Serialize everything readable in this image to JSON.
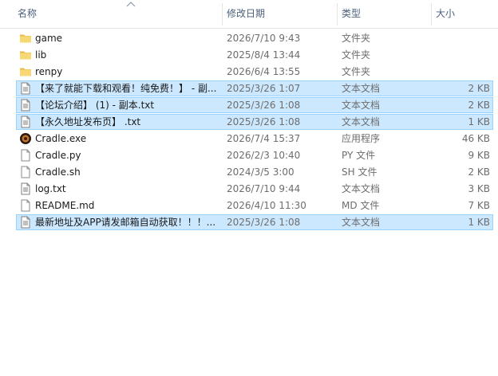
{
  "columns": {
    "name": "名称",
    "date": "修改日期",
    "type": "类型",
    "size": "大小"
  },
  "files": [
    {
      "name": "game",
      "date": "2026/7/10 9:43",
      "type": "文件夹",
      "size": "",
      "icon": "folder-icon",
      "selected": false
    },
    {
      "name": "lib",
      "date": "2025/8/4 13:44",
      "type": "文件夹",
      "size": "",
      "icon": "folder-icon",
      "selected": false
    },
    {
      "name": "renpy",
      "date": "2026/6/4 13:55",
      "type": "文件夹",
      "size": "",
      "icon": "folder-icon",
      "selected": false
    },
    {
      "name": "【来了就能下载和观看！纯免费！】 - 副...",
      "date": "2025/3/26 1:07",
      "type": "文本文档",
      "size": "2 KB",
      "icon": "text-file-icon",
      "selected": true
    },
    {
      "name": "【论坛介绍】 (1) - 副本.txt",
      "date": "2025/3/26 1:08",
      "type": "文本文档",
      "size": "2 KB",
      "icon": "text-file-icon",
      "selected": true
    },
    {
      "name": "【永久地址发布页】 .txt",
      "date": "2025/3/26 1:08",
      "type": "文本文档",
      "size": "1 KB",
      "icon": "text-file-icon",
      "selected": true
    },
    {
      "name": "Cradle.exe",
      "date": "2026/7/4 15:37",
      "type": "应用程序",
      "size": "46 KB",
      "icon": "app-exe-icon",
      "selected": false
    },
    {
      "name": "Cradle.py",
      "date": "2026/2/3 10:40",
      "type": "PY 文件",
      "size": "9 KB",
      "icon": "blank-file-icon",
      "selected": false
    },
    {
      "name": "Cradle.sh",
      "date": "2024/3/5 3:00",
      "type": "SH 文件",
      "size": "2 KB",
      "icon": "blank-file-icon",
      "selected": false
    },
    {
      "name": "log.txt",
      "date": "2026/7/10 9:44",
      "type": "文本文档",
      "size": "3 KB",
      "icon": "text-file-icon",
      "selected": false
    },
    {
      "name": "README.md",
      "date": "2026/4/10 11:30",
      "type": "MD 文件",
      "size": "7 KB",
      "icon": "blank-file-icon",
      "selected": false
    },
    {
      "name": "最新地址及APP请发邮箱自动获取！！！...",
      "date": "2025/3/26 1:08",
      "type": "文本文档",
      "size": "1 KB",
      "icon": "text-file-icon",
      "selected": true
    }
  ],
  "colors": {
    "selection_bg": "#cce8ff",
    "selection_border": "#99d1ff",
    "folder": "#f8d775",
    "header_text": "#4c607a"
  }
}
